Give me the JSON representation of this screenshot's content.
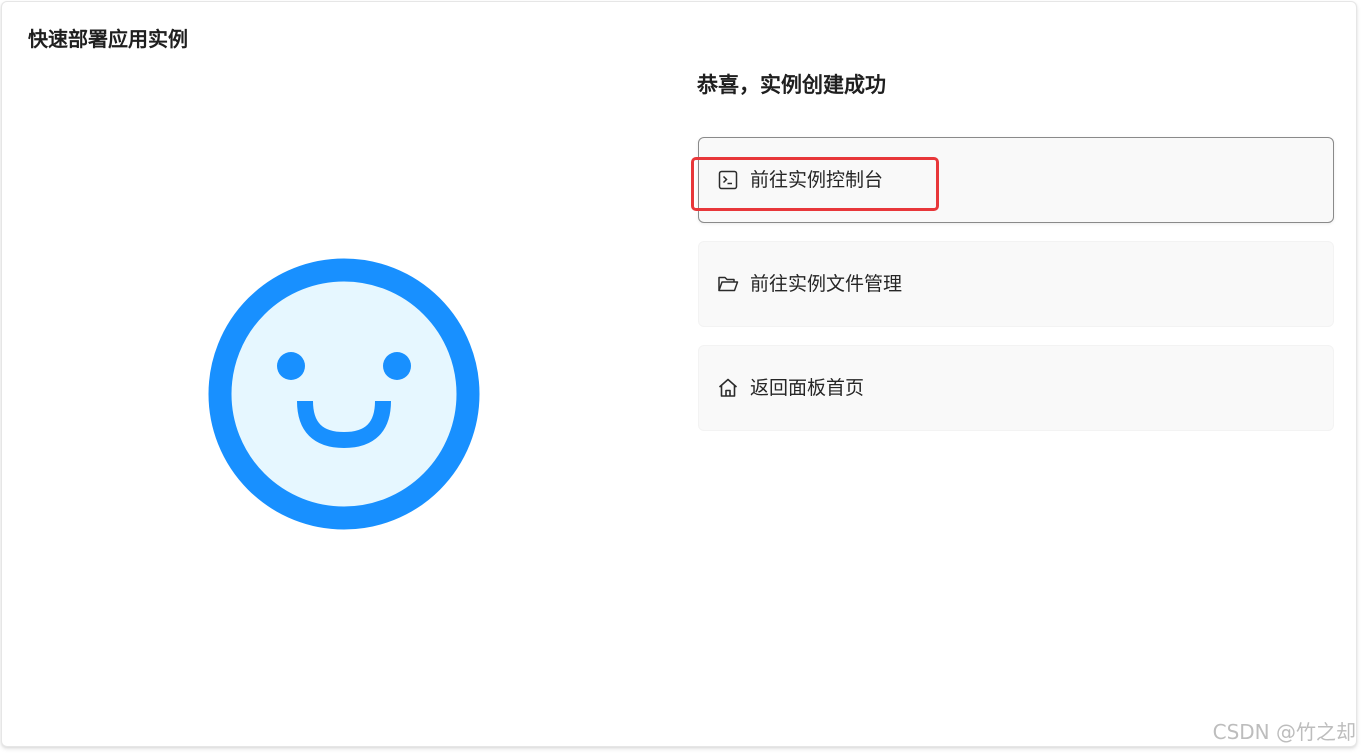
{
  "page": {
    "title": "快速部署应用实例"
  },
  "result": {
    "title": "恭喜，实例创建成功",
    "illustration_icon": "smiley-face-icon",
    "accent_color": "#1890ff",
    "face_fill_color": "#e6f7ff"
  },
  "actions": [
    {
      "label": "前往实例控制台",
      "icon": "terminal-icon"
    },
    {
      "label": "前往实例文件管理",
      "icon": "folder-open-icon"
    },
    {
      "label": "返回面板首页",
      "icon": "home-icon"
    }
  ],
  "annotation": {
    "color": "#e8373a"
  },
  "watermark": {
    "text": "CSDN @竹之却"
  }
}
